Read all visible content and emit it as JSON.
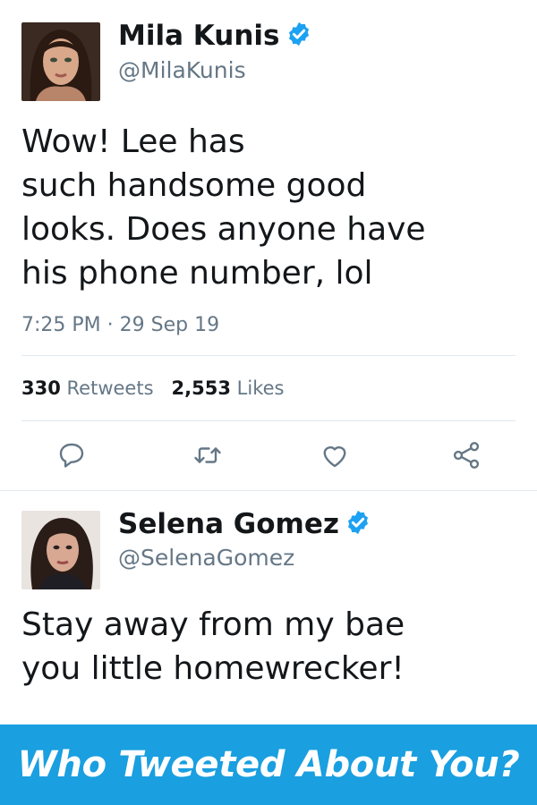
{
  "tweets": [
    {
      "display_name": "Mila Kunis",
      "handle": "@MilaKunis",
      "verified": true,
      "text_lines": [
        "Wow! Lee has",
        "such handsome good",
        "looks. Does anyone have",
        "his phone number, lol"
      ],
      "timestamp": "7:25 PM · 29 Sep 19",
      "retweets_count": "330",
      "retweets_label": "Retweets",
      "likes_count": "2,553",
      "likes_label": "Likes",
      "actions": [
        "reply-icon",
        "retweet-icon",
        "like-icon",
        "share-icon"
      ]
    },
    {
      "display_name": "Selena Gomez",
      "handle": "@SelenaGomez",
      "verified": true,
      "text_lines": [
        "Stay away from my bae",
        "you little homewrecker!"
      ]
    }
  ],
  "banner": {
    "text": "Who Tweeted About You?"
  },
  "colors": {
    "verified_badge": "#1da1f2",
    "banner_background": "#1a9fe0",
    "secondary_text": "#657786",
    "icon_gray": "#657786"
  }
}
